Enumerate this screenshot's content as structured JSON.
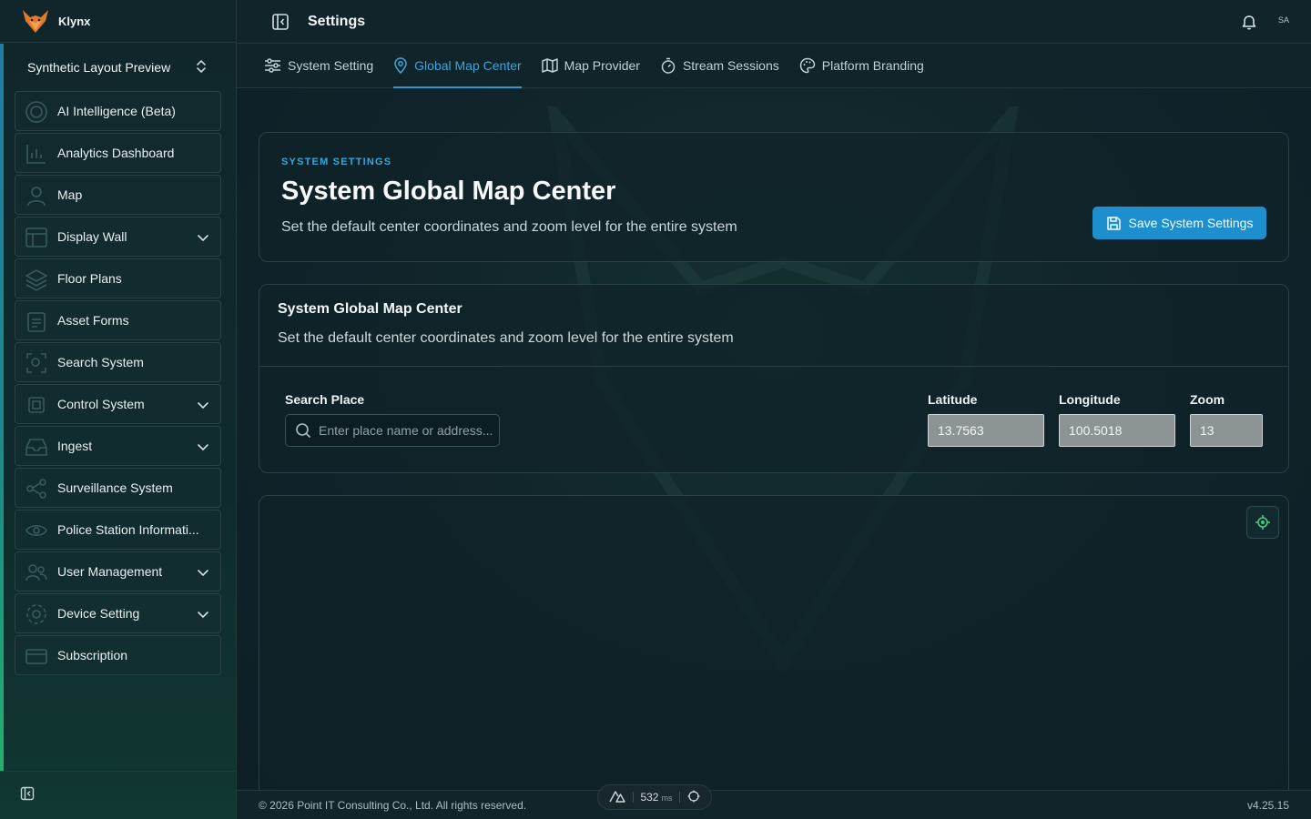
{
  "app": {
    "name": "Klynx"
  },
  "workspace": {
    "label": "Synthetic Layout Preview"
  },
  "sidebar": {
    "items": [
      {
        "label": "AI Intelligence (Beta)",
        "expandable": false
      },
      {
        "label": "Analytics Dashboard",
        "expandable": false
      },
      {
        "label": "Map",
        "expandable": false
      },
      {
        "label": "Display Wall",
        "expandable": true
      },
      {
        "label": "Floor Plans",
        "expandable": false
      },
      {
        "label": "Asset Forms",
        "expandable": false
      },
      {
        "label": "Search System",
        "expandable": false
      },
      {
        "label": "Control System",
        "expandable": true
      },
      {
        "label": "Ingest",
        "expandable": true
      },
      {
        "label": "Surveillance System",
        "expandable": false
      },
      {
        "label": "Police Station Informati...",
        "expandable": false
      },
      {
        "label": "User Management",
        "expandable": true
      },
      {
        "label": "Device Setting",
        "expandable": true
      },
      {
        "label": "Subscription",
        "expandable": false
      }
    ]
  },
  "header": {
    "title": "Settings",
    "avatar_initials": "SA"
  },
  "tabs": [
    {
      "label": "System Setting",
      "icon": "sliders-icon"
    },
    {
      "label": "Global Map Center",
      "icon": "map-pin-icon",
      "active": true
    },
    {
      "label": "Map Provider",
      "icon": "map-icon"
    },
    {
      "label": "Stream Sessions",
      "icon": "timer-icon"
    },
    {
      "label": "Platform Branding",
      "icon": "palette-icon"
    }
  ],
  "hero": {
    "eyebrow": "SYSTEM SETTINGS",
    "title": "System Global Map Center",
    "subtitle": "Set the default center coordinates and zoom level for the entire system",
    "save_label": "Save System Settings"
  },
  "form": {
    "title": "System Global Map Center",
    "subtitle": "Set the default center coordinates and zoom level for the entire system",
    "search_label": "Search Place",
    "search_placeholder": "Enter place name or address...",
    "latitude_label": "Latitude",
    "latitude_value": "13.7563",
    "longitude_label": "Longitude",
    "longitude_value": "100.5018",
    "zoom_label": "Zoom",
    "zoom_value": "13"
  },
  "footer": {
    "copyright": "© 2026 Point IT Consulting Co., Ltd. All rights reserved.",
    "version": "v4.25.15"
  },
  "devbar": {
    "latency": "532",
    "unit": "ms"
  },
  "colors": {
    "accent": "#2e98cf",
    "primary_button": "#1d8fcf",
    "locate_icon": "#3fcf7a"
  }
}
